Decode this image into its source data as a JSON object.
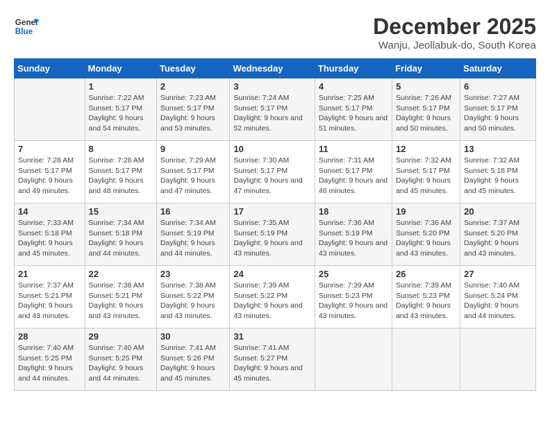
{
  "logo": {
    "line1": "General",
    "line2": "Blue"
  },
  "header": {
    "title": "December 2025",
    "location": "Wanju, Jeollabuk-do, South Korea"
  },
  "days_of_week": [
    "Sunday",
    "Monday",
    "Tuesday",
    "Wednesday",
    "Thursday",
    "Friday",
    "Saturday"
  ],
  "weeks": [
    [
      {
        "day": "",
        "info": ""
      },
      {
        "day": "1",
        "info": "Sunrise: 7:22 AM\nSunset: 5:17 PM\nDaylight: 9 hours\nand 54 minutes."
      },
      {
        "day": "2",
        "info": "Sunrise: 7:23 AM\nSunset: 5:17 PM\nDaylight: 9 hours\nand 53 minutes."
      },
      {
        "day": "3",
        "info": "Sunrise: 7:24 AM\nSunset: 5:17 PM\nDaylight: 9 hours\nand 52 minutes."
      },
      {
        "day": "4",
        "info": "Sunrise: 7:25 AM\nSunset: 5:17 PM\nDaylight: 9 hours\nand 51 minutes."
      },
      {
        "day": "5",
        "info": "Sunrise: 7:26 AM\nSunset: 5:17 PM\nDaylight: 9 hours\nand 50 minutes."
      },
      {
        "day": "6",
        "info": "Sunrise: 7:27 AM\nSunset: 5:17 PM\nDaylight: 9 hours\nand 50 minutes."
      }
    ],
    [
      {
        "day": "7",
        "info": "Sunrise: 7:28 AM\nSunset: 5:17 PM\nDaylight: 9 hours\nand 49 minutes."
      },
      {
        "day": "8",
        "info": "Sunrise: 7:28 AM\nSunset: 5:17 PM\nDaylight: 9 hours\nand 48 minutes."
      },
      {
        "day": "9",
        "info": "Sunrise: 7:29 AM\nSunset: 5:17 PM\nDaylight: 9 hours\nand 47 minutes."
      },
      {
        "day": "10",
        "info": "Sunrise: 7:30 AM\nSunset: 5:17 PM\nDaylight: 9 hours\nand 47 minutes."
      },
      {
        "day": "11",
        "info": "Sunrise: 7:31 AM\nSunset: 5:17 PM\nDaylight: 9 hours\nand 46 minutes."
      },
      {
        "day": "12",
        "info": "Sunrise: 7:32 AM\nSunset: 5:17 PM\nDaylight: 9 hours\nand 45 minutes."
      },
      {
        "day": "13",
        "info": "Sunrise: 7:32 AM\nSunset: 5:18 PM\nDaylight: 9 hours\nand 45 minutes."
      }
    ],
    [
      {
        "day": "14",
        "info": "Sunrise: 7:33 AM\nSunset: 5:18 PM\nDaylight: 9 hours\nand 45 minutes."
      },
      {
        "day": "15",
        "info": "Sunrise: 7:34 AM\nSunset: 5:18 PM\nDaylight: 9 hours\nand 44 minutes."
      },
      {
        "day": "16",
        "info": "Sunrise: 7:34 AM\nSunset: 5:19 PM\nDaylight: 9 hours\nand 44 minutes."
      },
      {
        "day": "17",
        "info": "Sunrise: 7:35 AM\nSunset: 5:19 PM\nDaylight: 9 hours\nand 43 minutes."
      },
      {
        "day": "18",
        "info": "Sunrise: 7:36 AM\nSunset: 5:19 PM\nDaylight: 9 hours\nand 43 minutes."
      },
      {
        "day": "19",
        "info": "Sunrise: 7:36 AM\nSunset: 5:20 PM\nDaylight: 9 hours\nand 43 minutes."
      },
      {
        "day": "20",
        "info": "Sunrise: 7:37 AM\nSunset: 5:20 PM\nDaylight: 9 hours\nand 43 minutes."
      }
    ],
    [
      {
        "day": "21",
        "info": "Sunrise: 7:37 AM\nSunset: 5:21 PM\nDaylight: 9 hours\nand 43 minutes."
      },
      {
        "day": "22",
        "info": "Sunrise: 7:38 AM\nSunset: 5:21 PM\nDaylight: 9 hours\nand 43 minutes."
      },
      {
        "day": "23",
        "info": "Sunrise: 7:38 AM\nSunset: 5:22 PM\nDaylight: 9 hours\nand 43 minutes."
      },
      {
        "day": "24",
        "info": "Sunrise: 7:39 AM\nSunset: 5:22 PM\nDaylight: 9 hours\nand 43 minutes."
      },
      {
        "day": "25",
        "info": "Sunrise: 7:39 AM\nSunset: 5:23 PM\nDaylight: 9 hours\nand 43 minutes."
      },
      {
        "day": "26",
        "info": "Sunrise: 7:39 AM\nSunset: 5:23 PM\nDaylight: 9 hours\nand 43 minutes."
      },
      {
        "day": "27",
        "info": "Sunrise: 7:40 AM\nSunset: 5:24 PM\nDaylight: 9 hours\nand 44 minutes."
      }
    ],
    [
      {
        "day": "28",
        "info": "Sunrise: 7:40 AM\nSunset: 5:25 PM\nDaylight: 9 hours\nand 44 minutes."
      },
      {
        "day": "29",
        "info": "Sunrise: 7:40 AM\nSunset: 5:25 PM\nDaylight: 9 hours\nand 44 minutes."
      },
      {
        "day": "30",
        "info": "Sunrise: 7:41 AM\nSunset: 5:26 PM\nDaylight: 9 hours\nand 45 minutes."
      },
      {
        "day": "31",
        "info": "Sunrise: 7:41 AM\nSunset: 5:27 PM\nDaylight: 9 hours\nand 45 minutes."
      },
      {
        "day": "",
        "info": ""
      },
      {
        "day": "",
        "info": ""
      },
      {
        "day": "",
        "info": ""
      }
    ]
  ]
}
